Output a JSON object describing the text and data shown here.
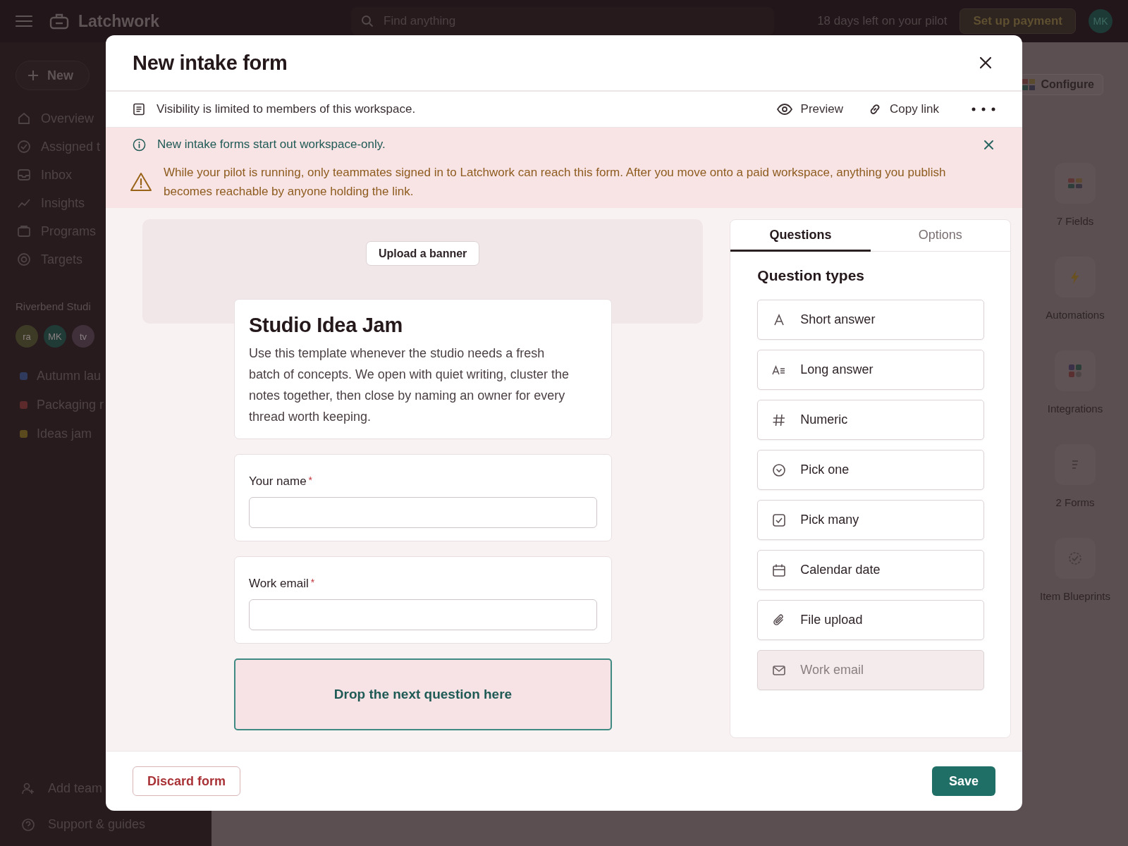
{
  "topbar": {
    "app_name": "Latchwork",
    "search": {
      "placeholder": "Find anything"
    },
    "trial_note": "18 days left on your pilot",
    "payment_button": "Set up payment",
    "avatar": "MK"
  },
  "sidebar": {
    "new_button": "New",
    "items": [
      {
        "kind": "home",
        "label": "Overview"
      },
      {
        "kind": "check",
        "label": "Assigned t"
      },
      {
        "kind": "inbox",
        "label": "Inbox"
      },
      {
        "kind": "trend",
        "label": "Insights"
      },
      {
        "kind": "folder",
        "label": "Programs"
      },
      {
        "kind": "target",
        "label": "Targets"
      }
    ],
    "section_title": "Riverbend Studi",
    "members": [
      {
        "initials": "ra",
        "color": "#3d3a26"
      },
      {
        "initials": "MK",
        "color": "#203a36"
      },
      {
        "initials": "tv",
        "color": "#40303a"
      }
    ],
    "projects": [
      {
        "label": "Autumn lau",
        "color": "#2f3a5c"
      },
      {
        "label": "Packaging r",
        "color": "#5c2a2a"
      },
      {
        "label": "Ideas jam",
        "color": "#5a4a1e"
      }
    ],
    "footer_items": [
      {
        "kind": "person",
        "label": "Add team"
      },
      {
        "kind": "help",
        "label": "Support & guides"
      }
    ]
  },
  "main": {
    "configure_button": "Configure",
    "rail": [
      {
        "kind": "fields",
        "label": "7 Fields"
      },
      {
        "kind": "bolt",
        "label": "Automations"
      },
      {
        "kind": "apps",
        "label": "Integrations"
      },
      {
        "kind": "forms",
        "label": "2 Forms"
      },
      {
        "kind": "blueprint",
        "label": "Item Blueprints"
      }
    ]
  },
  "dialog": {
    "title": "New intake form",
    "visibility_note": "Visibility is limited to members of this workspace.",
    "actions": [
      {
        "kind": "preview",
        "label": "Preview"
      },
      {
        "kind": "link",
        "label": "Copy link"
      }
    ],
    "info_banner": "New intake forms start out workspace-only.",
    "warning": "While your pilot is running, only teammates signed in to Latchwork can reach this form. After you move onto a paid workspace, anything you publish becomes reachable by anyone holding the link.",
    "upload_button": "Upload a banner",
    "form": {
      "title": "Studio Idea Jam",
      "description": "Use this template whenever the studio needs a fresh batch of concepts. We open with quiet writing, cluster the notes together, then close by naming an owner for every thread worth keeping.",
      "fields": [
        {
          "label": "Your name",
          "required_mark": "*"
        },
        {
          "label": "Work email",
          "required_mark": "*"
        }
      ],
      "drop_zone": "Drop the next question here"
    },
    "tabs": [
      {
        "label": "Questions",
        "selected": true
      },
      {
        "label": "Options",
        "selected": false
      }
    ],
    "palette_title": "Question types",
    "question_types": [
      {
        "kind": "short",
        "label": "Short answer",
        "disabled": false
      },
      {
        "kind": "long",
        "label": "Long answer",
        "disabled": false
      },
      {
        "kind": "numeric",
        "label": "Numeric",
        "disabled": false
      },
      {
        "kind": "single",
        "label": "Pick one",
        "disabled": false
      },
      {
        "kind": "multi",
        "label": "Pick many",
        "disabled": false
      },
      {
        "kind": "date",
        "label": "Calendar date",
        "disabled": false
      },
      {
        "kind": "file",
        "label": "File upload",
        "disabled": false
      },
      {
        "kind": "email",
        "label": "Work email",
        "disabled": true
      }
    ],
    "discard_button": "Discard form",
    "save_button": "Save"
  }
}
